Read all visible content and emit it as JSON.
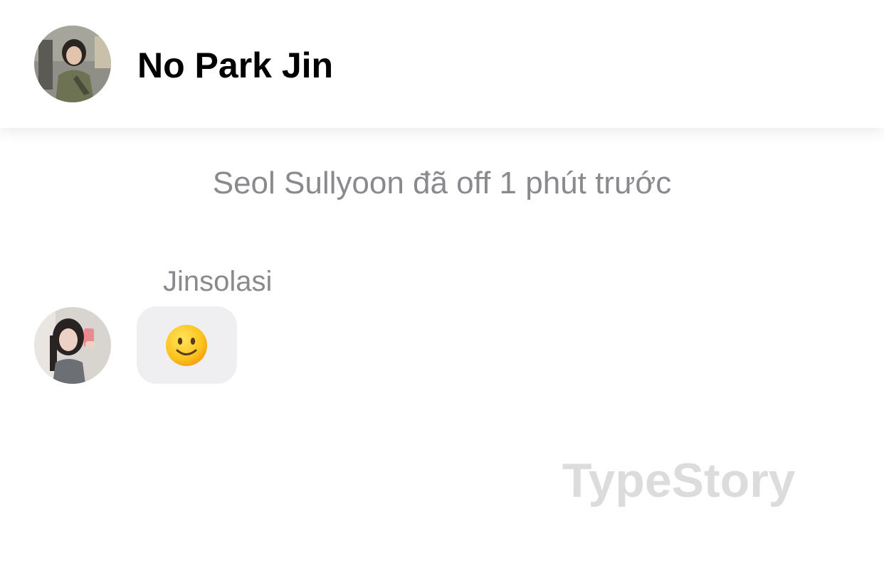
{
  "header": {
    "title": "No Park Jin",
    "avatar_icon": "group-avatar-photo"
  },
  "status": {
    "text": "Seol Sullyoon đã off 1 phút trước"
  },
  "messages": [
    {
      "sender": "Jinsolasi",
      "avatar_icon": "user-avatar-photo",
      "content_icon": "slightly-smiling-face-emoji"
    }
  ],
  "watermark": {
    "text": "TypeStory"
  },
  "colors": {
    "background": "#ffffff",
    "secondary_text": "#8a8a8e",
    "bubble": "#efeff2",
    "watermark": "#dcdcdc"
  }
}
